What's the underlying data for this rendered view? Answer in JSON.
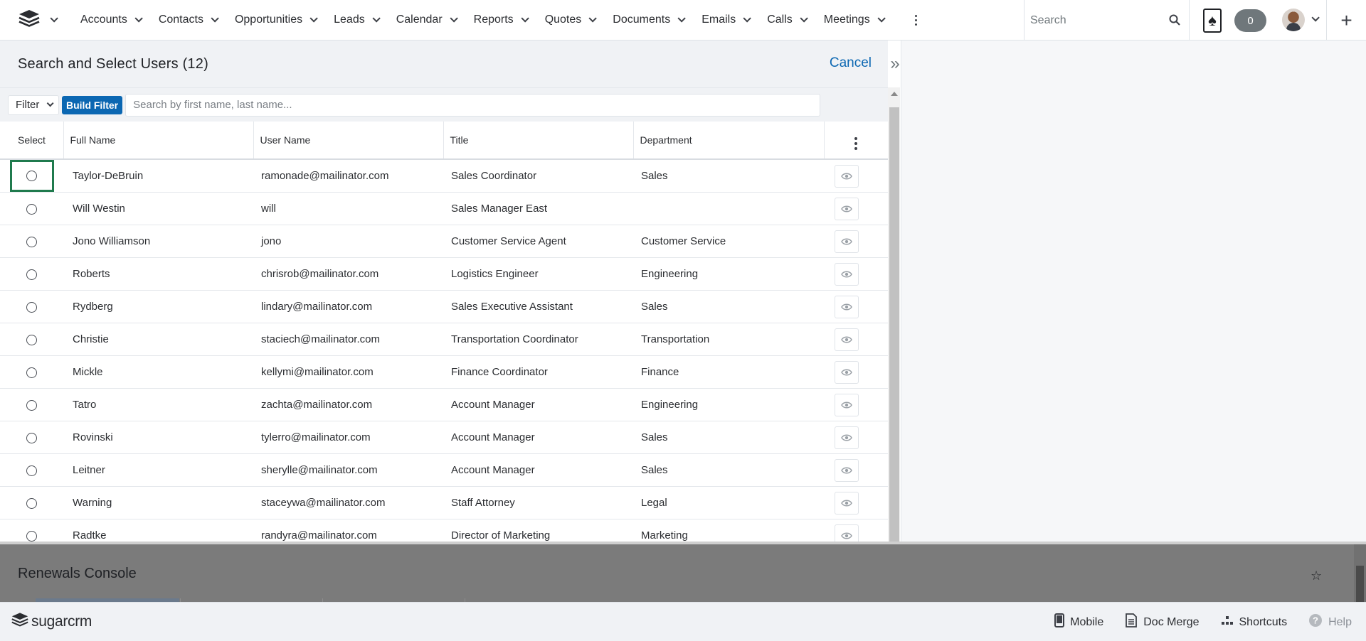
{
  "nav": {
    "items": [
      {
        "label": "Accounts"
      },
      {
        "label": "Contacts"
      },
      {
        "label": "Opportunities"
      },
      {
        "label": "Leads"
      },
      {
        "label": "Calendar"
      },
      {
        "label": "Reports"
      },
      {
        "label": "Quotes"
      },
      {
        "label": "Documents"
      },
      {
        "label": "Emails"
      },
      {
        "label": "Calls"
      },
      {
        "label": "Meetings"
      }
    ],
    "search_placeholder": "Search",
    "notification_count": "0"
  },
  "drawer": {
    "title": "Search and Select Users (12)",
    "cancel_label": "Cancel",
    "filter_label": "Filter",
    "build_filter_label": "Build Filter",
    "search_placeholder": "Search by first name, last name..."
  },
  "table": {
    "columns": [
      "Select",
      "Full Name",
      "User Name",
      "Title",
      "Department"
    ],
    "rows": [
      {
        "full_name": "Taylor-DeBruin",
        "user_name": "ramonade@mailinator.com",
        "title": "Sales Coordinator",
        "department": "Sales"
      },
      {
        "full_name": "Will Westin",
        "user_name": "will",
        "title": "Sales Manager East",
        "department": ""
      },
      {
        "full_name": "Jono Williamson",
        "user_name": "jono",
        "title": "Customer Service Agent",
        "department": "Customer Service"
      },
      {
        "full_name": "Roberts",
        "user_name": "chrisrob@mailinator.com",
        "title": "Logistics Engineer",
        "department": "Engineering"
      },
      {
        "full_name": "Rydberg",
        "user_name": "lindary@mailinator.com",
        "title": "Sales Executive Assistant",
        "department": "Sales"
      },
      {
        "full_name": "Christie",
        "user_name": "staciech@mailinator.com",
        "title": "Transportation Coordinator",
        "department": "Transportation"
      },
      {
        "full_name": "Mickle",
        "user_name": "kellymi@mailinator.com",
        "title": "Finance Coordinator",
        "department": "Finance"
      },
      {
        "full_name": "Tatro",
        "user_name": "zachta@mailinator.com",
        "title": "Account Manager",
        "department": "Engineering"
      },
      {
        "full_name": "Rovinski",
        "user_name": "tylerro@mailinator.com",
        "title": "Account Manager",
        "department": "Sales"
      },
      {
        "full_name": "Leitner",
        "user_name": "sherylle@mailinator.com",
        "title": "Account Manager",
        "department": "Sales"
      },
      {
        "full_name": "Warning",
        "user_name": "staceywa@mailinator.com",
        "title": "Staff Attorney",
        "department": "Legal"
      },
      {
        "full_name": "Radtke",
        "user_name": "randyra@mailinator.com",
        "title": "Director of Marketing",
        "department": "Marketing"
      }
    ]
  },
  "dashlet": {
    "title": "Renewals Console"
  },
  "footer": {
    "brand": "sugarcrm",
    "links": [
      {
        "label": "Mobile",
        "icon": "mobile-icon"
      },
      {
        "label": "Doc Merge",
        "icon": "document-icon"
      },
      {
        "label": "Shortcuts",
        "icon": "shortcuts-icon"
      },
      {
        "label": "Help",
        "icon": "help-icon"
      }
    ]
  },
  "colors": {
    "accent": "#0b67b2",
    "focus": "#1f7a4d",
    "overlay": "#7b7b7b"
  }
}
